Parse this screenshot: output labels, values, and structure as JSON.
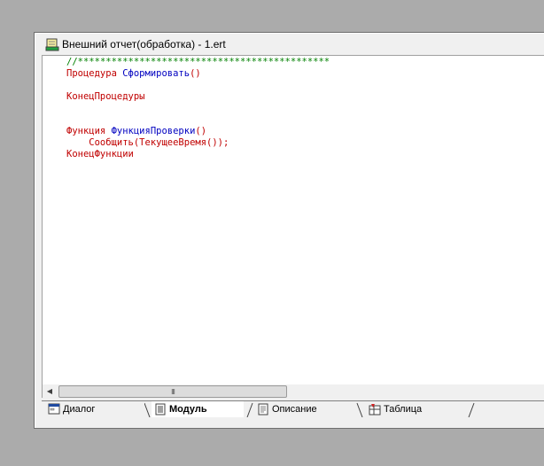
{
  "window": {
    "title": "Внешний отчет(обработка) - 1.ert"
  },
  "editor": {
    "lines": [
      {
        "parts": [
          {
            "t": "//",
            "c": "c-green"
          },
          {
            "t": "*********************************************",
            "c": "c-green"
          }
        ]
      },
      {
        "parts": [
          {
            "t": "Процедура ",
            "c": "c-red"
          },
          {
            "t": "Сформировать",
            "c": "c-blue"
          },
          {
            "t": "()",
            "c": "c-red"
          }
        ]
      },
      {
        "parts": []
      },
      {
        "parts": [
          {
            "t": "КонецПроцедуры",
            "c": "c-red"
          }
        ]
      },
      {
        "parts": []
      },
      {
        "parts": []
      },
      {
        "parts": [
          {
            "t": "Функция ",
            "c": "c-red"
          },
          {
            "t": "ФункцияПроверки",
            "c": "c-blue"
          },
          {
            "t": "()",
            "c": "c-red"
          }
        ]
      },
      {
        "parts": [
          {
            "t": "    Сообщить(ТекущееВремя());",
            "c": "c-red"
          }
        ]
      },
      {
        "parts": [
          {
            "t": "КонецФункции",
            "c": "c-red"
          }
        ]
      }
    ]
  },
  "scrollbar": {
    "grip": "III"
  },
  "tabs": [
    {
      "label": "Диалог",
      "icon": "dialog-icon",
      "active": false
    },
    {
      "label": "Модуль",
      "icon": "module-icon",
      "active": true
    },
    {
      "label": "Описание",
      "icon": "description-icon",
      "active": false
    },
    {
      "label": "Таблица",
      "icon": "table-icon",
      "active": false
    }
  ]
}
